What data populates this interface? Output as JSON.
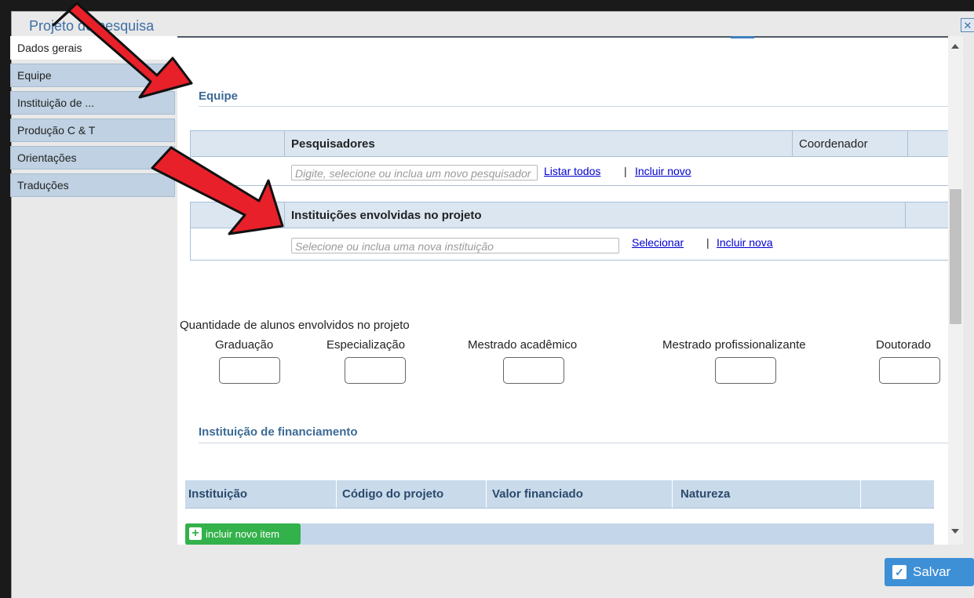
{
  "dialog": {
    "title": "Projeto de pesquisa",
    "close_icon": "close-icon"
  },
  "tabs": [
    {
      "label": "Dados gerais",
      "active": true
    },
    {
      "label": "Equipe",
      "active": false
    },
    {
      "label": "Instituição de ...",
      "active": false
    },
    {
      "label": "Produção C & T",
      "active": false
    },
    {
      "label": "Orientações",
      "active": false
    },
    {
      "label": "Traduções",
      "active": false
    }
  ],
  "equipe": {
    "section_title": "Equipe",
    "researchers_table": {
      "header": "Pesquisadores",
      "coordinator_header": "Coordenador",
      "input_placeholder": "Digite, selecione ou inclua um novo pesquisador",
      "list_all": "Listar todos",
      "separator": "|",
      "include_new": "Incluir novo"
    },
    "institutions_table": {
      "header": "Instituições envolvidas no projeto",
      "input_placeholder": "Selecione ou inclua uma nova instituição",
      "select": "Selecionar",
      "separator": "|",
      "include_new": "Incluir nova"
    }
  },
  "students": {
    "label": "Quantidade de alunos envolvidos no projeto",
    "fields": [
      "Graduação",
      "Especialização",
      "Mestrado acadêmico",
      "Mestrado profissionalizante",
      "Doutorado"
    ]
  },
  "financing": {
    "section_title": "Instituição de financiamento",
    "columns": [
      "Instituição",
      "Código do projeto",
      "Valor financiado",
      "Natureza"
    ],
    "add_button": "incluir novo item"
  },
  "footer": {
    "save_label": "Salvar"
  },
  "annotation_color": "#e8202a"
}
